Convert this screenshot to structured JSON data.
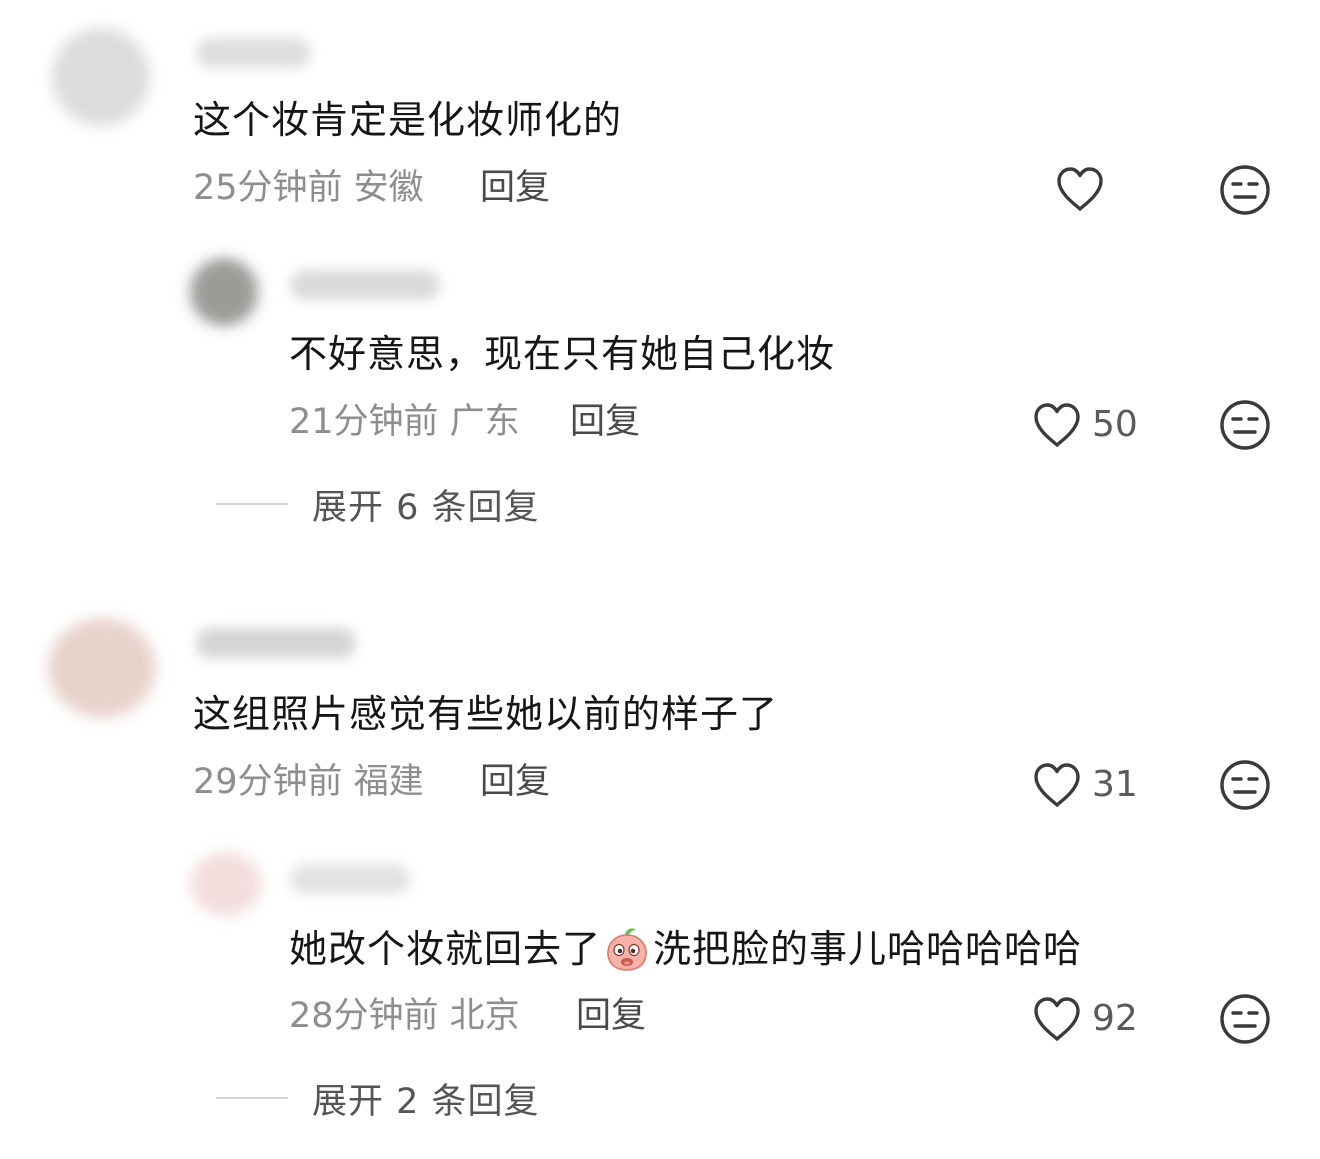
{
  "comments": [
    {
      "text": "这个妆肯定是化妆师化的",
      "meta": "25分钟前 安徽",
      "reply_label": "回复",
      "like_count": ""
    },
    {
      "text": "不好意思，现在只有她自己化妆",
      "meta": "21分钟前 广东",
      "reply_label": "回复",
      "like_count": "50"
    },
    {
      "text": "这组照片感觉有些她以前的样子了",
      "meta": "29分钟前 福建",
      "reply_label": "回复",
      "like_count": "31"
    },
    {
      "text_before_emoji": "她改个妆就回去了",
      "text_after_emoji": "洗把脸的事儿哈哈哈哈哈",
      "emoji_icon": "peach-face-emoji-icon",
      "meta": "28分钟前 北京",
      "reply_label": "回复",
      "like_count": "92"
    }
  ],
  "expand_replies": [
    {
      "label": "展开 6 条回复"
    },
    {
      "label": "展开 2 条回复"
    }
  ],
  "icons": {
    "like": "heart-outline-icon",
    "dislike": "meh-face-icon"
  },
  "colors": {
    "text": "#161616",
    "meta": "#8e8e8e",
    "icon": "#3a3a3a"
  }
}
